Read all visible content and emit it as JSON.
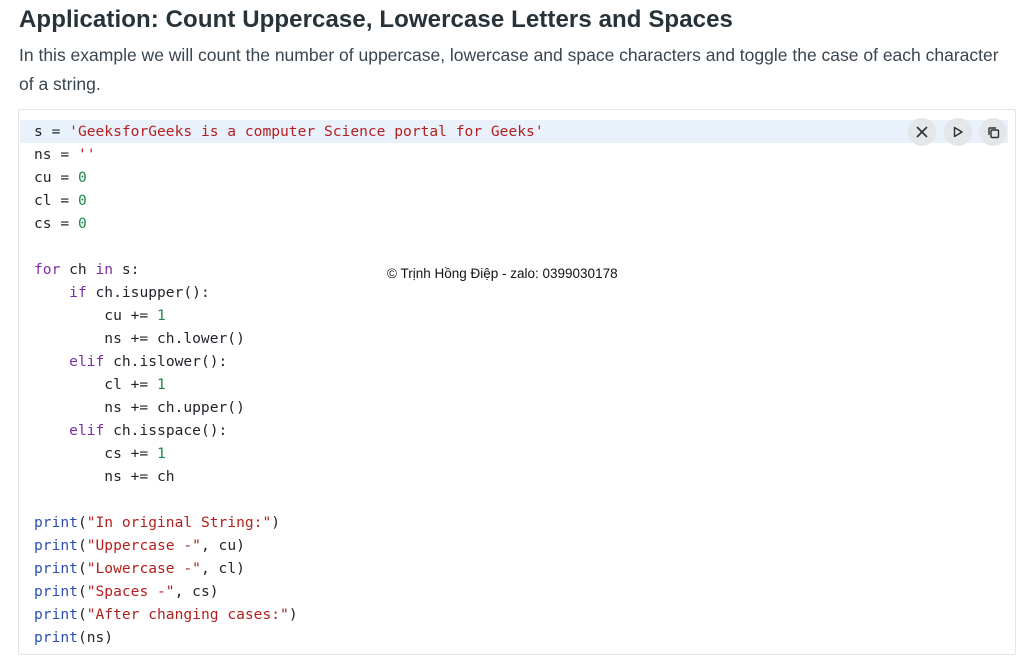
{
  "heading": "Application: Count Uppercase, Lowercase Letters and Spaces",
  "description": "In this example we will count the number of uppercase, lowercase and space characters and toggle the case of each character of a string.",
  "code_lines": [
    [
      [
        "s = ",
        ""
      ],
      [
        "'GeeksforGeeks is a computer Science portal for Geeks'",
        "st"
      ]
    ],
    [
      [
        "ns = ",
        ""
      ],
      [
        "''",
        "st"
      ]
    ],
    [
      [
        "cu = ",
        ""
      ],
      [
        "0",
        "nm"
      ]
    ],
    [
      [
        "cl = ",
        ""
      ],
      [
        "0",
        "nm"
      ]
    ],
    [
      [
        "cs = ",
        ""
      ],
      [
        "0",
        "nm"
      ]
    ],
    [],
    [
      [
        "for",
        "kw"
      ],
      [
        " ch ",
        ""
      ],
      [
        "in",
        "kw"
      ],
      [
        " s:",
        ""
      ]
    ],
    [
      [
        "    ",
        ""
      ],
      [
        "if",
        "kw"
      ],
      [
        " ch.isupper():",
        ""
      ]
    ],
    [
      [
        "        cu += ",
        ""
      ],
      [
        "1",
        "nm"
      ]
    ],
    [
      [
        "        ns += ch.lower()",
        ""
      ]
    ],
    [
      [
        "    ",
        ""
      ],
      [
        "elif",
        "kw"
      ],
      [
        " ch.islower():",
        ""
      ]
    ],
    [
      [
        "        cl += ",
        ""
      ],
      [
        "1",
        "nm"
      ]
    ],
    [
      [
        "        ns += ch.upper()",
        ""
      ]
    ],
    [
      [
        "    ",
        ""
      ],
      [
        "elif",
        "kw"
      ],
      [
        " ch.isspace():",
        ""
      ]
    ],
    [
      [
        "        cs += ",
        ""
      ],
      [
        "1",
        "nm"
      ]
    ],
    [
      [
        "        ns += ch",
        ""
      ]
    ],
    [],
    [
      [
        "print",
        "fn"
      ],
      [
        "(",
        ""
      ],
      [
        "\"In original String:\"",
        "st"
      ],
      [
        ")",
        ""
      ]
    ],
    [
      [
        "print",
        "fn"
      ],
      [
        "(",
        ""
      ],
      [
        "\"Uppercase -\"",
        "st"
      ],
      [
        ", cu)",
        ""
      ]
    ],
    [
      [
        "print",
        "fn"
      ],
      [
        "(",
        ""
      ],
      [
        "\"Lowercase -\"",
        "st"
      ],
      [
        ", cl)",
        ""
      ]
    ],
    [
      [
        "print",
        "fn"
      ],
      [
        "(",
        ""
      ],
      [
        "\"Spaces -\"",
        "st"
      ],
      [
        ", cs)",
        ""
      ]
    ],
    [
      [
        "print",
        "fn"
      ],
      [
        "(",
        ""
      ],
      [
        "\"After changing cases:\"",
        "st"
      ],
      [
        ")",
        ""
      ]
    ],
    [
      [
        "print",
        "fn"
      ],
      [
        "(ns)",
        ""
      ]
    ]
  ],
  "toolbar": {
    "close_icon": "close-icon",
    "run_icon": "play-icon",
    "copy_icon": "copy-icon"
  },
  "watermark": "© Trịnh Hồng Điệp - zalo: 0399030178",
  "colors": {
    "keyword": "#7a2ea3",
    "function": "#2a4fb0",
    "string": "#b41f1f",
    "number": "#1d8a4c",
    "highlight": "#e9f1fb"
  }
}
